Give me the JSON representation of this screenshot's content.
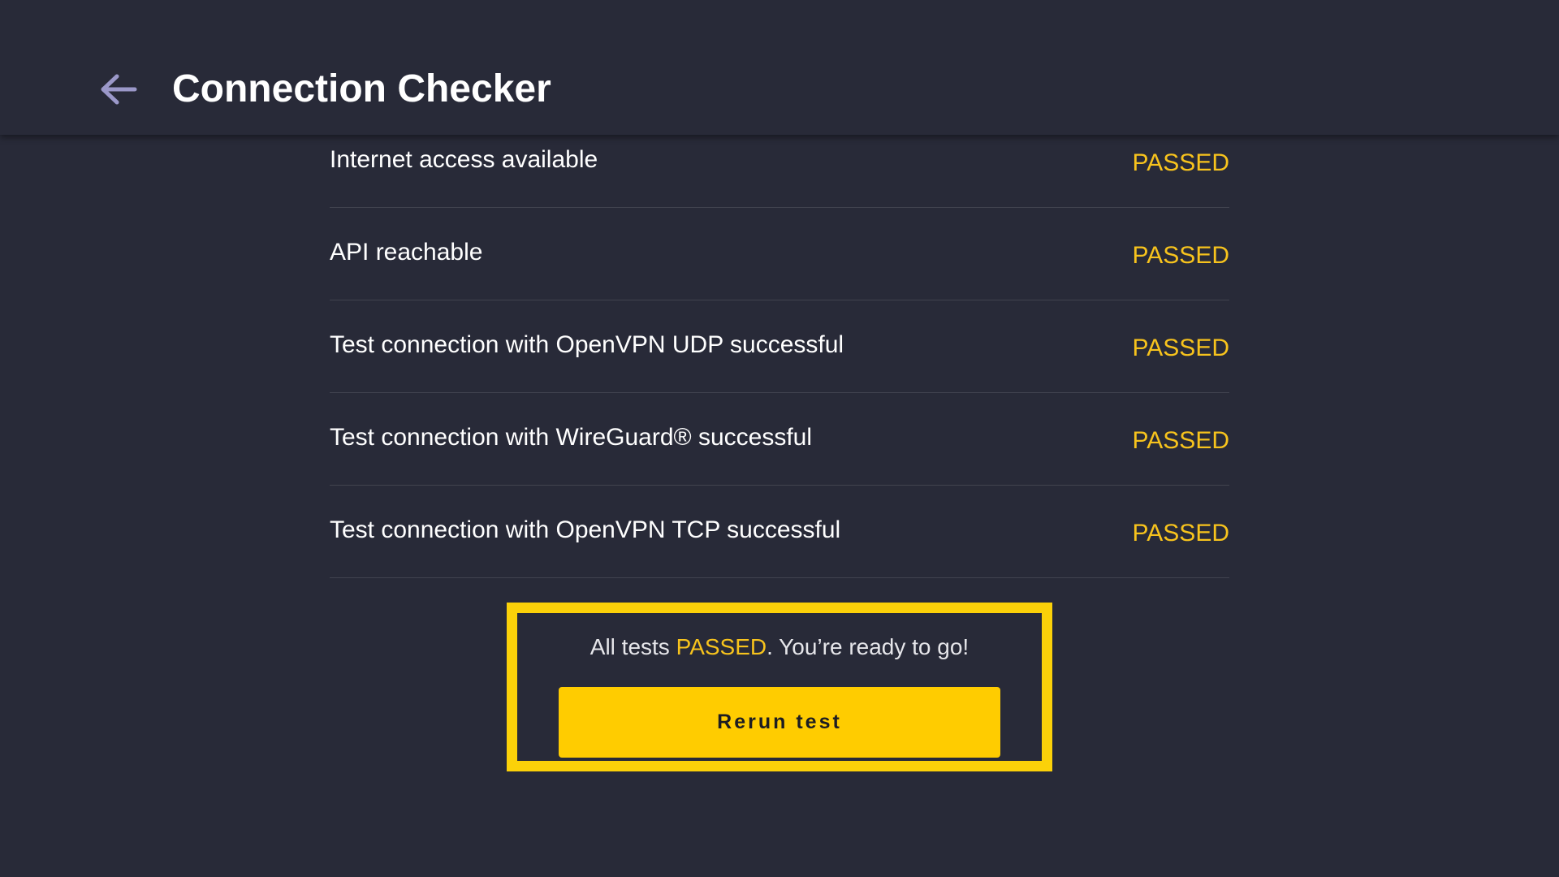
{
  "header": {
    "back_icon": "arrow-left-icon",
    "title": "Connection Checker"
  },
  "colors": {
    "background": "#282a38",
    "accent": "#ffcc00",
    "status_passed": "#f7c31d",
    "back_icon": "#9b98c9"
  },
  "tests": [
    {
      "label": "Internet access available",
      "status": "PASSED"
    },
    {
      "label": "API reachable",
      "status": "PASSED"
    },
    {
      "label": "Test connection with OpenVPN UDP successful",
      "status": "PASSED"
    },
    {
      "label": "Test connection with WireGuard® successful",
      "status": "PASSED"
    },
    {
      "label": "Test connection with OpenVPN TCP successful",
      "status": "PASSED"
    }
  ],
  "result": {
    "prefix": "All tests ",
    "highlight": "PASSED",
    "suffix": ". You’re ready to go!",
    "button_label": "Rerun test"
  }
}
